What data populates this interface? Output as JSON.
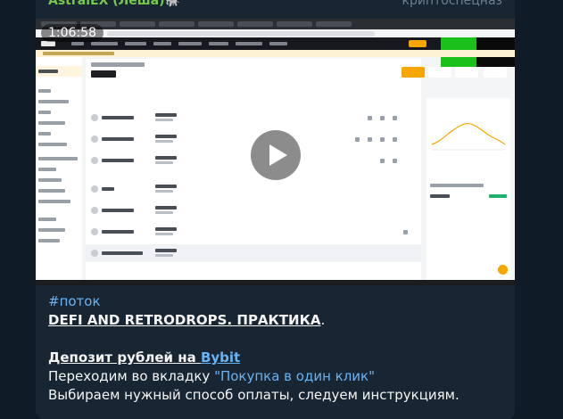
{
  "message": {
    "author": "AstralEX (Леша)🐘",
    "channel": "криптоспецназ",
    "video": {
      "duration": "1:06:58"
    },
    "caption": {
      "hashtag": "#поток",
      "headline": "DEFI AND RETRODROPS. ПРАКТИКА",
      "headline_suffix": ".",
      "section_title": "Депозит рублей на ",
      "section_link": "Bybit",
      "line1_prefix": "Переходим во вкладку ",
      "line1_quote": "\"Покупка в один клик\"",
      "line2": "Выбираем нужный способ оплаты, следуем инструкциям."
    }
  },
  "colors": {
    "author": "#76c84d",
    "link": "#6ab3f3",
    "bubble": "#182533",
    "background": "#0f1b27",
    "bybit_accent": "#f7a600"
  }
}
